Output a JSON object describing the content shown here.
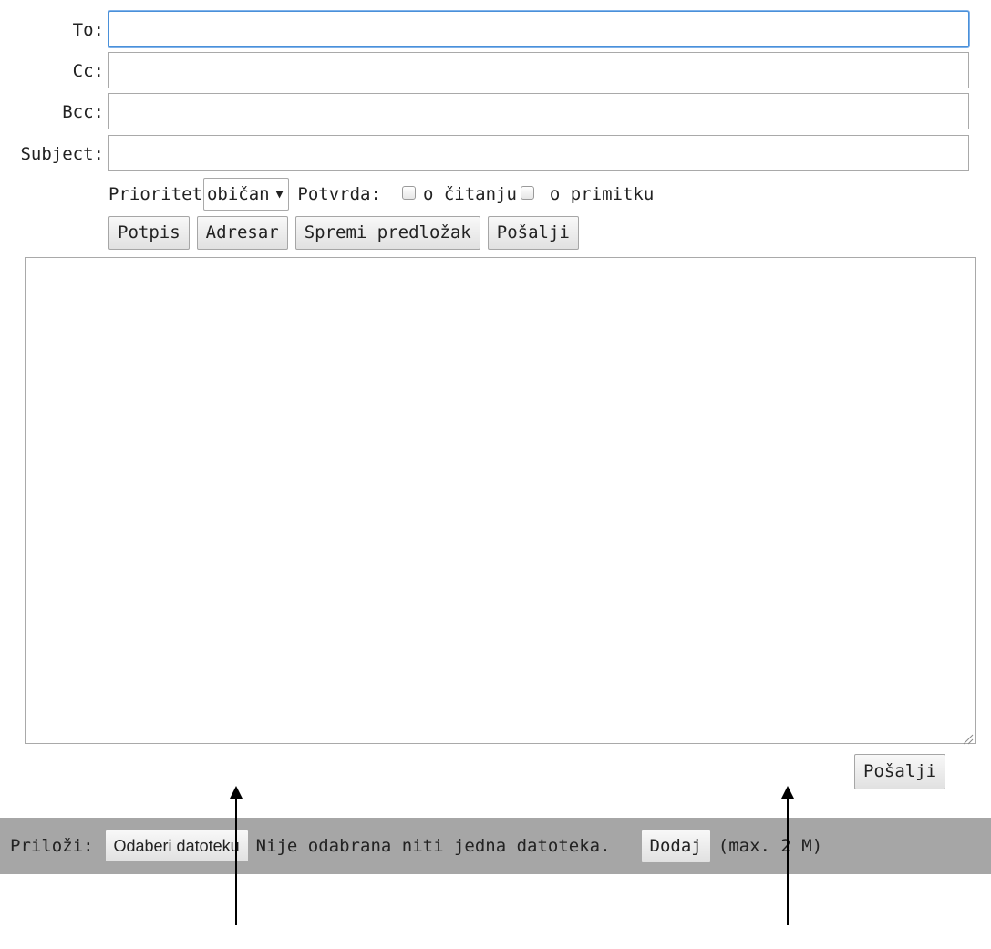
{
  "header_fields": {
    "to_label": "To:",
    "cc_label": "Cc:",
    "bcc_label": "Bcc:",
    "subject_label": "Subject:",
    "to_value": "",
    "cc_value": "",
    "bcc_value": "",
    "subject_value": ""
  },
  "options": {
    "priority_label": "Prioritet",
    "priority_selected": "običan",
    "confirm_label": "Potvrda:",
    "read_receipt_label": "o čitanju",
    "delivery_receipt_label": "o primitku",
    "read_receipt_checked": false,
    "delivery_receipt_checked": false
  },
  "toolbar": {
    "signature_label": "Potpis",
    "address_book_label": "Adresar",
    "save_template_label": "Spremi predložak",
    "send_label": "Pošalji"
  },
  "message": {
    "body": ""
  },
  "footer": {
    "send_label": "Pošalji"
  },
  "attachments": {
    "label": "Priloži:",
    "choose_file_label": "Odaberi datoteku",
    "no_file_text": "Nije odabrana niti jedna datoteka.",
    "add_label": "Dodaj",
    "max_size_text": "(max. 2 M)"
  },
  "colors": {
    "attach_bar": "#a6a6a6",
    "focus_border": "#4a90d9"
  },
  "icons": {
    "dropdown": "dropdown-arrow-icon",
    "resize": "resize-grip-icon",
    "pointer": "arrow-up-icon"
  }
}
